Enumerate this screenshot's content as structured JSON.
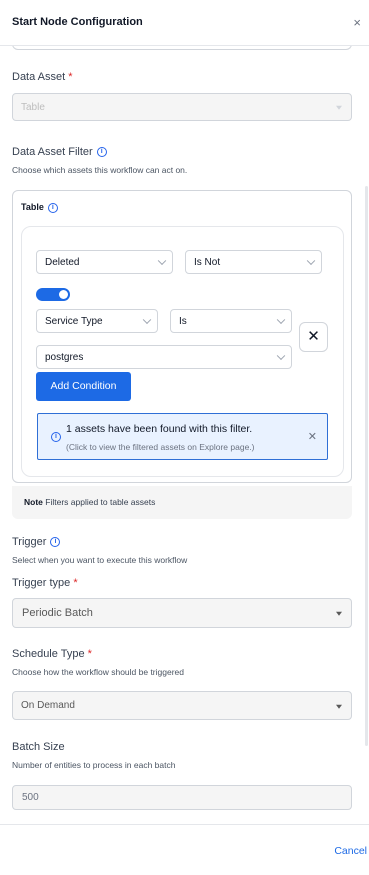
{
  "header": {
    "title": "Start Node Configuration",
    "close_glyph": "×"
  },
  "data_asset": {
    "label": "Data Asset",
    "required_mark": "*",
    "value": "Table"
  },
  "filter": {
    "label": "Data Asset Filter",
    "help": "Choose which assets this workflow can act on.",
    "card_title": "Table",
    "rows": [
      {
        "field": "Deleted",
        "operator": "Is Not"
      },
      {
        "field": "Service Type",
        "operator": "Is",
        "value": "postgres"
      }
    ],
    "toggle_on": true,
    "remove_glyph": "✕",
    "add_condition": "Add Condition",
    "alert_title": "1 assets have been found with this filter.",
    "alert_sub": "(Click to view the filtered assets on Explore page.)",
    "note_bold": "Note",
    "note_text": "Filters applied to table assets"
  },
  "trigger": {
    "label": "Trigger",
    "help": "Select when you want to execute this workflow",
    "type_label": "Trigger type",
    "type_value": "Periodic Batch"
  },
  "schedule": {
    "label": "Schedule Type",
    "help": "Choose how the workflow should be triggered",
    "value": "On Demand"
  },
  "batch": {
    "label": "Batch Size",
    "help": "Number of entities to process in each batch",
    "value": "500"
  },
  "footer": {
    "cancel": "Cancel"
  },
  "icons": {
    "info": "info-circle-icon",
    "close": "close-icon",
    "chevron": "chevron-down-icon"
  },
  "colors": {
    "primary": "#1d6ae5",
    "required": "#dc2626",
    "alert_bg": "#e9f2ff"
  }
}
